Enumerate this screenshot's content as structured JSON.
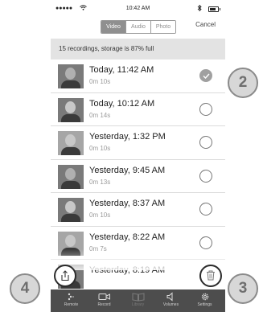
{
  "status_bar": {
    "signal": "●●●●●",
    "time": "10:42 AM"
  },
  "header": {
    "tabs": [
      {
        "label": "Video",
        "active": true
      },
      {
        "label": "Audio",
        "active": false
      },
      {
        "label": "Photo",
        "active": false
      }
    ],
    "cancel_label": "Cancel"
  },
  "storage_text": "15 recordings, storage is 87% full",
  "recordings": [
    {
      "title": "Today, 11:42 AM",
      "duration": "0m 10s",
      "selected": true
    },
    {
      "title": "Today, 10:12 AM",
      "duration": "0m 14s",
      "selected": false
    },
    {
      "title": "Yesterday, 1:32 PM",
      "duration": "0m 10s",
      "selected": false
    },
    {
      "title": "Yesterday, 9:45 AM",
      "duration": "0m 13s",
      "selected": false
    },
    {
      "title": "Yesterday, 8:37 AM",
      "duration": "0m 10s",
      "selected": false
    },
    {
      "title": "Yesterday, 8:22 AM",
      "duration": "0m 7s",
      "selected": false
    },
    {
      "title": "Yesterday, 8:19 AM",
      "duration": "",
      "selected": false
    }
  ],
  "tabbar": [
    {
      "label": "Remote",
      "icon": "remote-icon"
    },
    {
      "label": "Record",
      "icon": "video-camera-icon"
    },
    {
      "label": "Library",
      "icon": "book-icon"
    },
    {
      "label": "Volumes",
      "icon": "speaker-icon"
    },
    {
      "label": "Settings",
      "icon": "gear-icon"
    }
  ],
  "callouts": {
    "share": "4",
    "select": "2",
    "delete": "3"
  },
  "colors": {
    "tabbar_bg": "#4d4d4d",
    "storage_bg": "#e3e3e3",
    "segment_active": "#8f8f8f"
  }
}
